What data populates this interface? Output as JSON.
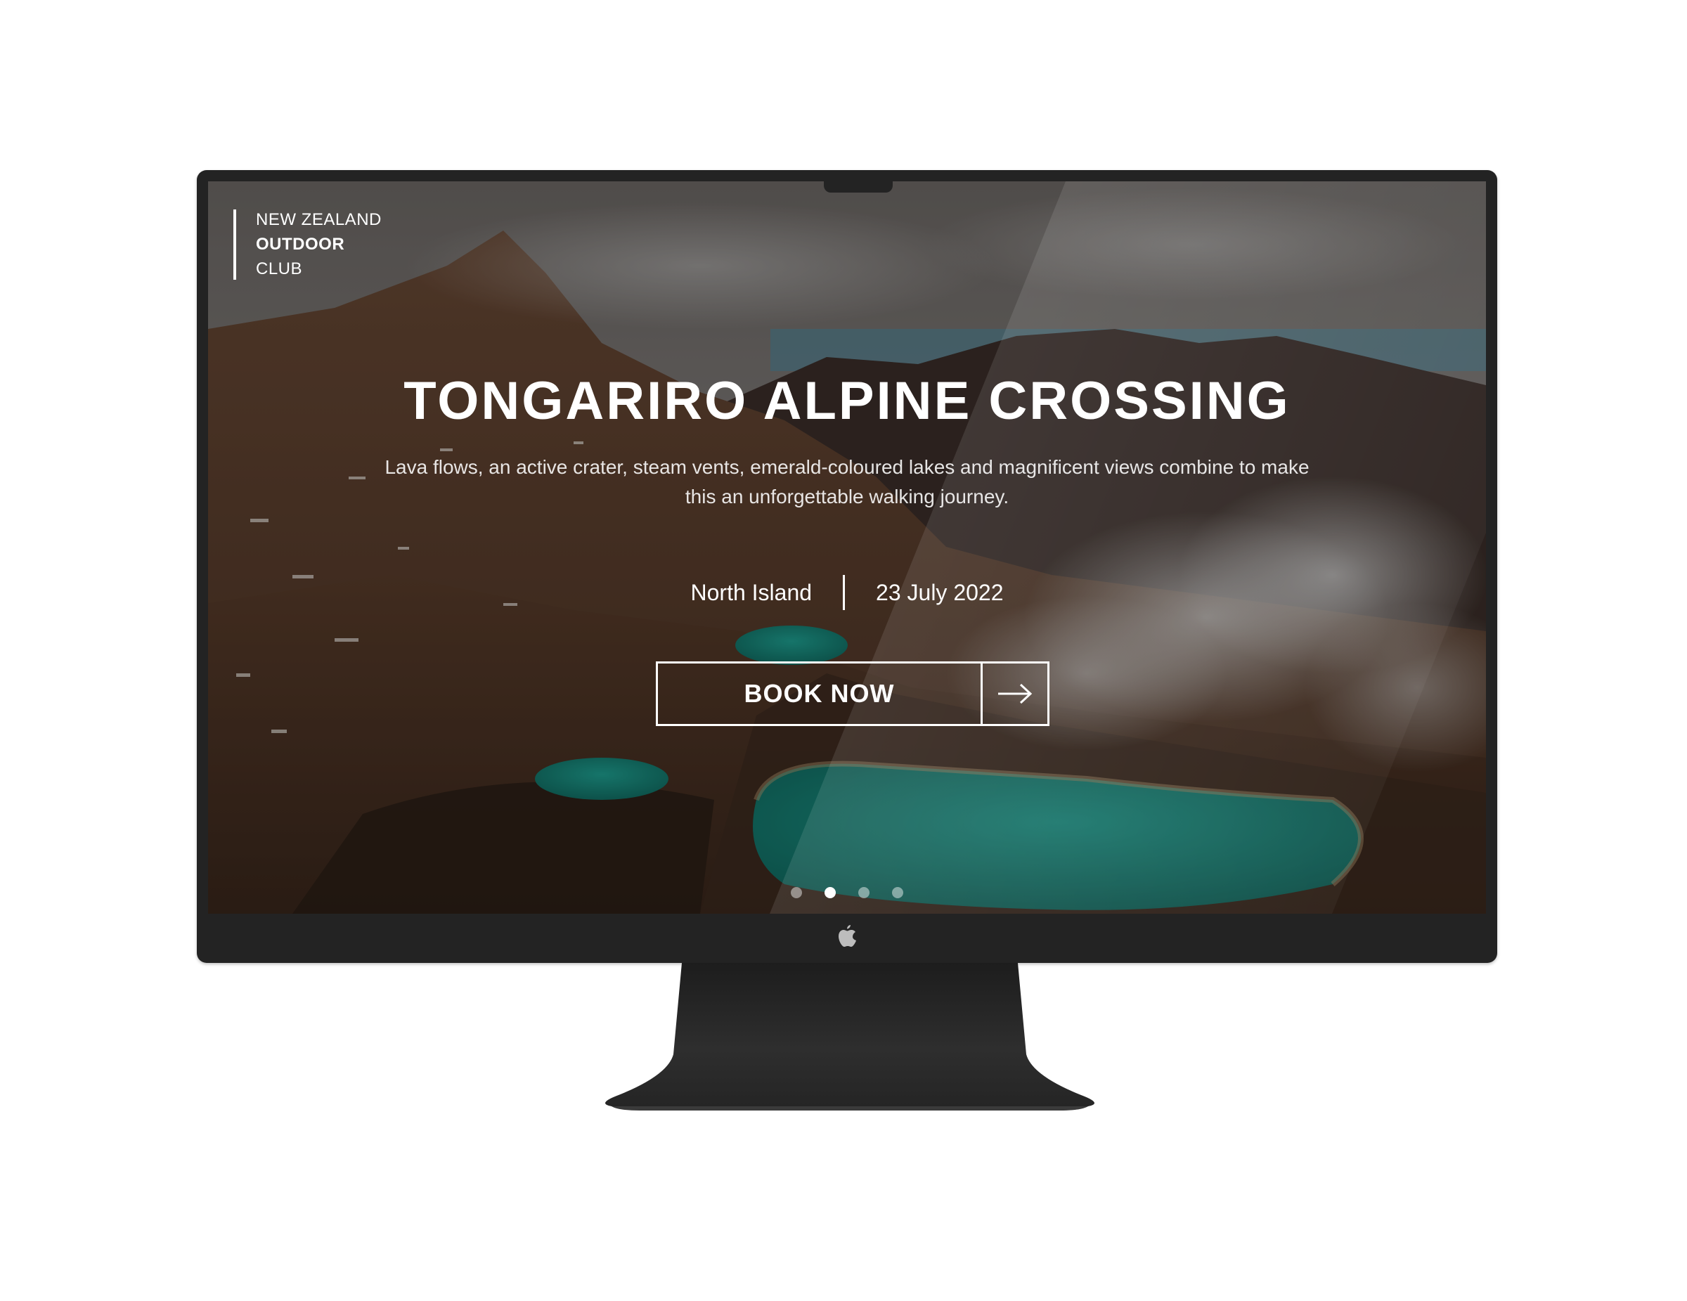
{
  "logo": {
    "line1": "NEW ZEALAND",
    "line2": "OUTDOOR",
    "line3": "CLUB"
  },
  "hero": {
    "title": "TONGARIRO ALPINE CROSSING",
    "description_line1": "Lava flows, an active crater, steam vents, emerald-coloured lakes and magnificent views combine to make",
    "description_line2": "this an unforgettable walking journey.",
    "location": "North Island",
    "date": "23 July 2022"
  },
  "cta": {
    "label": "BOOK NOW",
    "icon": "arrow-right-icon"
  },
  "carousel": {
    "slide_count": 4,
    "active_index": 1
  },
  "device": {
    "chin_icon": "apple-logo-icon"
  },
  "colors": {
    "bezel": "#232323",
    "text": "#ffffff",
    "lake": "#1b8f7f"
  }
}
